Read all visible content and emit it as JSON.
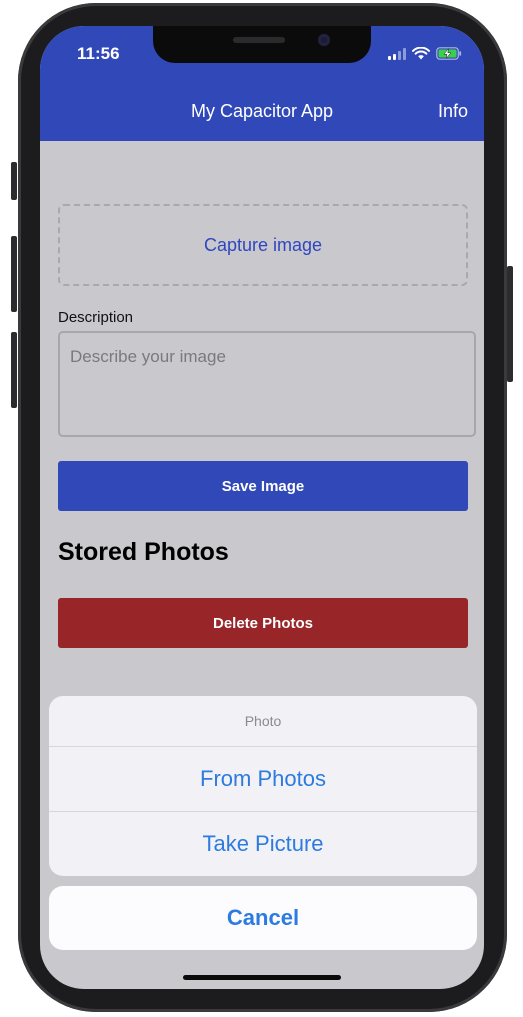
{
  "status_bar": {
    "time": "11:56"
  },
  "header": {
    "title": "My Capacitor App",
    "info_label": "Info"
  },
  "form": {
    "capture_label": "Capture image",
    "description_label": "Description",
    "description_placeholder": "Describe your image",
    "save_label": "Save Image"
  },
  "stored": {
    "title": "Stored Photos",
    "delete_label": "Delete Photos"
  },
  "action_sheet": {
    "title": "Photo",
    "options": [
      "From Photos",
      "Take Picture"
    ],
    "cancel_label": "Cancel"
  },
  "colors": {
    "header": "#3149b8",
    "primary_button": "#3149b8",
    "danger_button": "#982628",
    "sheet_text": "#2c7be0"
  },
  "icons": [
    "signal-icon",
    "wifi-icon",
    "battery-charging-icon"
  ]
}
